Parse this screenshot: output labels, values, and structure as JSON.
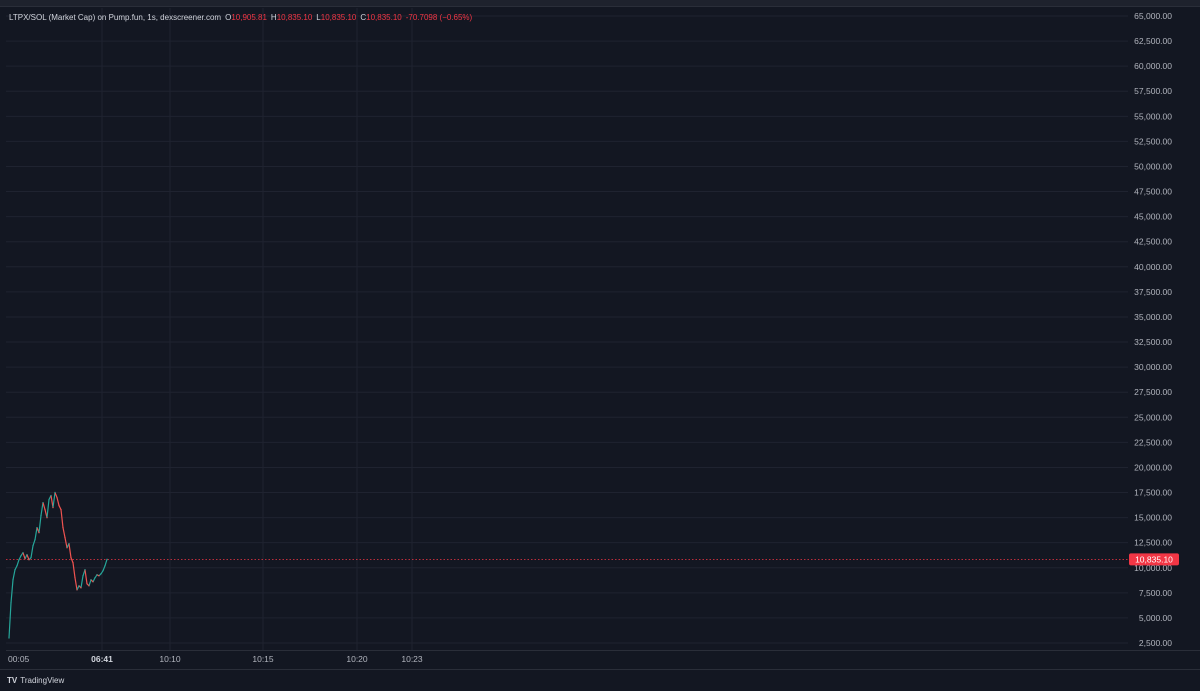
{
  "legend": {
    "symbol": "LTPX/SOL (Market Cap) on Pump.fun, 1s, dexscreener.com",
    "o_label": "O",
    "o_value": "10,905.81",
    "h_label": "H",
    "h_value": "10,835.10",
    "l_label": "L",
    "l_value": "10,835.10",
    "c_label": "C",
    "c_value": "10,835.10",
    "change": "-70.7098 (−0.65%)"
  },
  "footer": {
    "logo_glyph": "TV",
    "brand": "TradingView"
  },
  "colors": {
    "background": "#131722",
    "grid": "#1f2330",
    "text": "#b2b5be",
    "up": "#26a69a",
    "down": "#ef5350",
    "price_line": "#f23645"
  },
  "chart_data": {
    "type": "line",
    "title": "",
    "xlabel": "",
    "ylabel": "",
    "ylim": [
      2500,
      65000
    ],
    "y_ticks": [
      2500,
      5000,
      7500,
      10000,
      12500,
      15000,
      17500,
      20000,
      22500,
      25000,
      27500,
      30000,
      32500,
      35000,
      37500,
      40000,
      42500,
      45000,
      47500,
      50000,
      52500,
      55000,
      57500,
      60000,
      62500,
      65000
    ],
    "y_tick_labels": [
      "2,500.00",
      "5,000.00",
      "7,500.00",
      "10,000.00",
      "12,500.00",
      "15,000.00",
      "17,500.00",
      "20,000.00",
      "22,500.00",
      "25,000.00",
      "27,500.00",
      "30,000.00",
      "32,500.00",
      "35,000.00",
      "37,500.00",
      "40,000.00",
      "42,500.00",
      "45,000.00",
      "47,500.00",
      "50,000.00",
      "52,500.00",
      "55,000.00",
      "57,500.00",
      "60,000.00",
      "62,500.00",
      "65,000.00"
    ],
    "xlim": [
      0,
      1100
    ],
    "x_ticks": [
      {
        "x": 8,
        "label": "00:05",
        "bold": false
      },
      {
        "x": 102,
        "label": "06:41",
        "bold": true
      },
      {
        "x": 170,
        "label": "10:10",
        "bold": false
      },
      {
        "x": 263,
        "label": "10:15",
        "bold": false
      },
      {
        "x": 357,
        "label": "10:20",
        "bold": false
      },
      {
        "x": 412,
        "label": "10:23",
        "bold": false
      }
    ],
    "series": [
      {
        "x": [
          9,
          11,
          13,
          15,
          17,
          19,
          21,
          23,
          25,
          27,
          29,
          31,
          33,
          35,
          37,
          39,
          41,
          43,
          45,
          47,
          49,
          51,
          53,
          55,
          57,
          59,
          61,
          63,
          65,
          67,
          69,
          71,
          73,
          75,
          77,
          79,
          81,
          83,
          85,
          87,
          89,
          91,
          93,
          95,
          97,
          99,
          101,
          103,
          105,
          107
        ],
        "values": [
          3000,
          6500,
          8800,
          9800,
          10200,
          10800,
          11200,
          11500,
          10900,
          11300,
          10800,
          11000,
          12200,
          12800,
          14000,
          13500,
          15200,
          16500,
          15800,
          15000,
          16800,
          17200,
          16000,
          17500,
          17000,
          16200,
          15800,
          14000,
          13000,
          12000,
          12400,
          11000,
          10500,
          9000,
          7800,
          8200,
          8000,
          9200,
          9800,
          8400,
          8200,
          8800,
          8600,
          9000,
          9300,
          9200,
          9400,
          9700,
          10200,
          10835
        ]
      }
    ],
    "last_price": 10835.1,
    "last_price_label": "10,835.10",
    "grid": true
  }
}
